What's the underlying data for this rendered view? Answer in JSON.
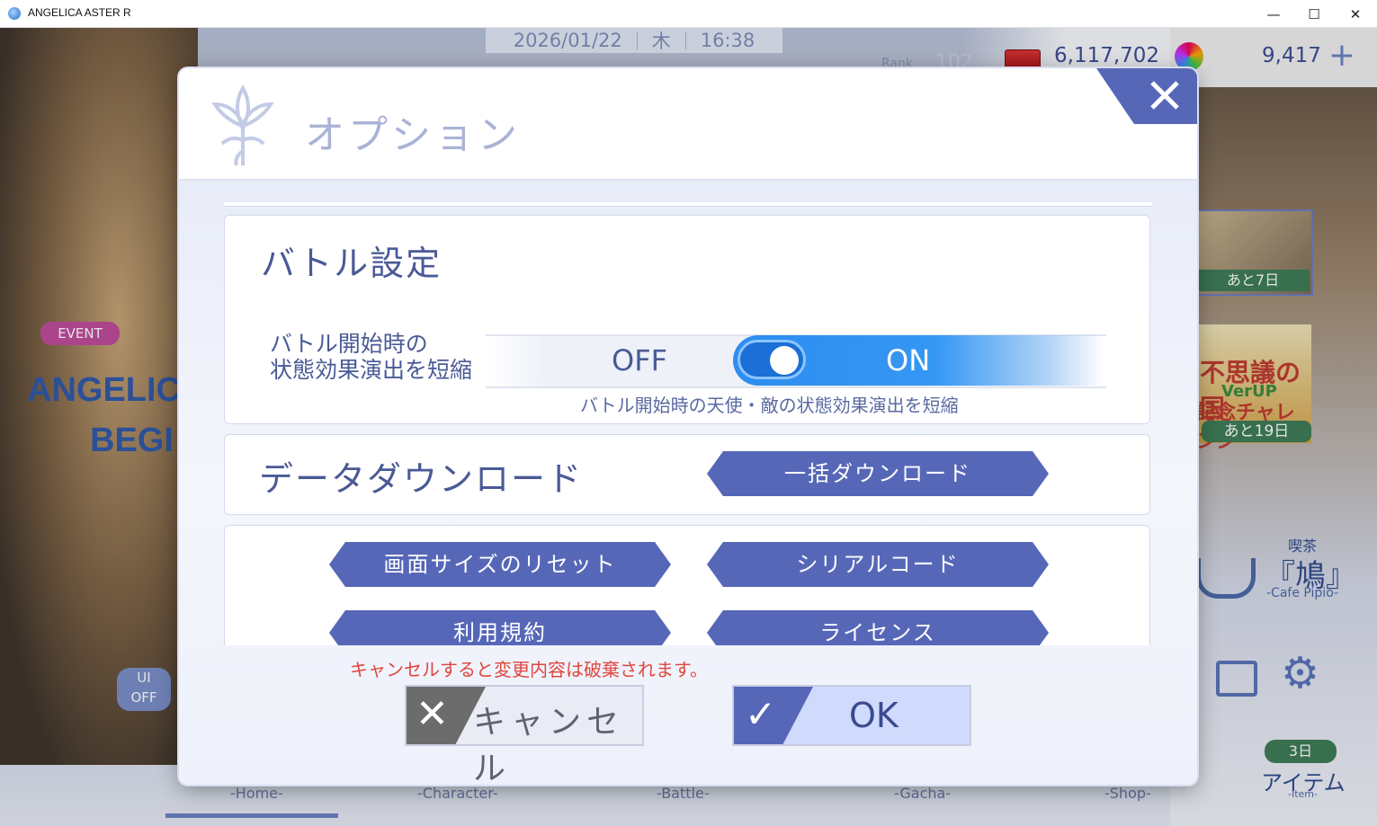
{
  "window": {
    "title": "ANGELICA ASTER R",
    "minimize": "—",
    "maximize": "☐",
    "close": "✕"
  },
  "hud": {
    "date": "2026/01/22",
    "weekday": "木",
    "time": "16:38",
    "rank_label": "Rank",
    "rank_value": "102",
    "gold": "6,117,702",
    "gems": "9,417",
    "plus": "+"
  },
  "background": {
    "event_badge": "EVENT",
    "event_title_1": "ANGELICA",
    "event_title_2": "BEGI",
    "ui_toggle": "UI",
    "ui_toggle_state": "OFF",
    "banner1_timer": "あと7日",
    "banner2_title": "不思議の国",
    "banner2_verup": "VerUP",
    "banner2_sub": "記念チャレンジ",
    "banner2_timer": "あと19日",
    "cafe_label": "喫茶",
    "cafe_name": "『鳩』",
    "cafe_sub": "-Cafe Pipio-",
    "item_timer": "3日",
    "item_label": "アイテム",
    "item_sub": "-Item-",
    "nav": [
      "-Home-",
      "-Character-",
      "-Battle-",
      "-Gacha-",
      "-Shop-"
    ]
  },
  "dialog": {
    "title": "オプション",
    "close_icon": "close-icon",
    "battle": {
      "heading": "バトル設定",
      "toggle_label_line1": "バトル開始時の",
      "toggle_label_line2": "状態効果演出を短縮",
      "off": "OFF",
      "on": "ON",
      "state": "ON",
      "description": "バトル開始時の天使・敵の状態効果演出を短縮"
    },
    "download": {
      "heading": "データダウンロード",
      "button": "一括ダウンロード"
    },
    "misc": {
      "reset_screen": "画面サイズのリセット",
      "serial_code": "シリアルコード",
      "terms": "利用規約",
      "license": "ライセンス"
    },
    "warning": "キャンセルすると変更内容は破棄されます。",
    "cancel_label": "キャンセル",
    "ok_label": "OK"
  },
  "colors": {
    "accent": "#5767b8",
    "toggle_on": "#2d8df0",
    "warning": "#e0453d"
  }
}
